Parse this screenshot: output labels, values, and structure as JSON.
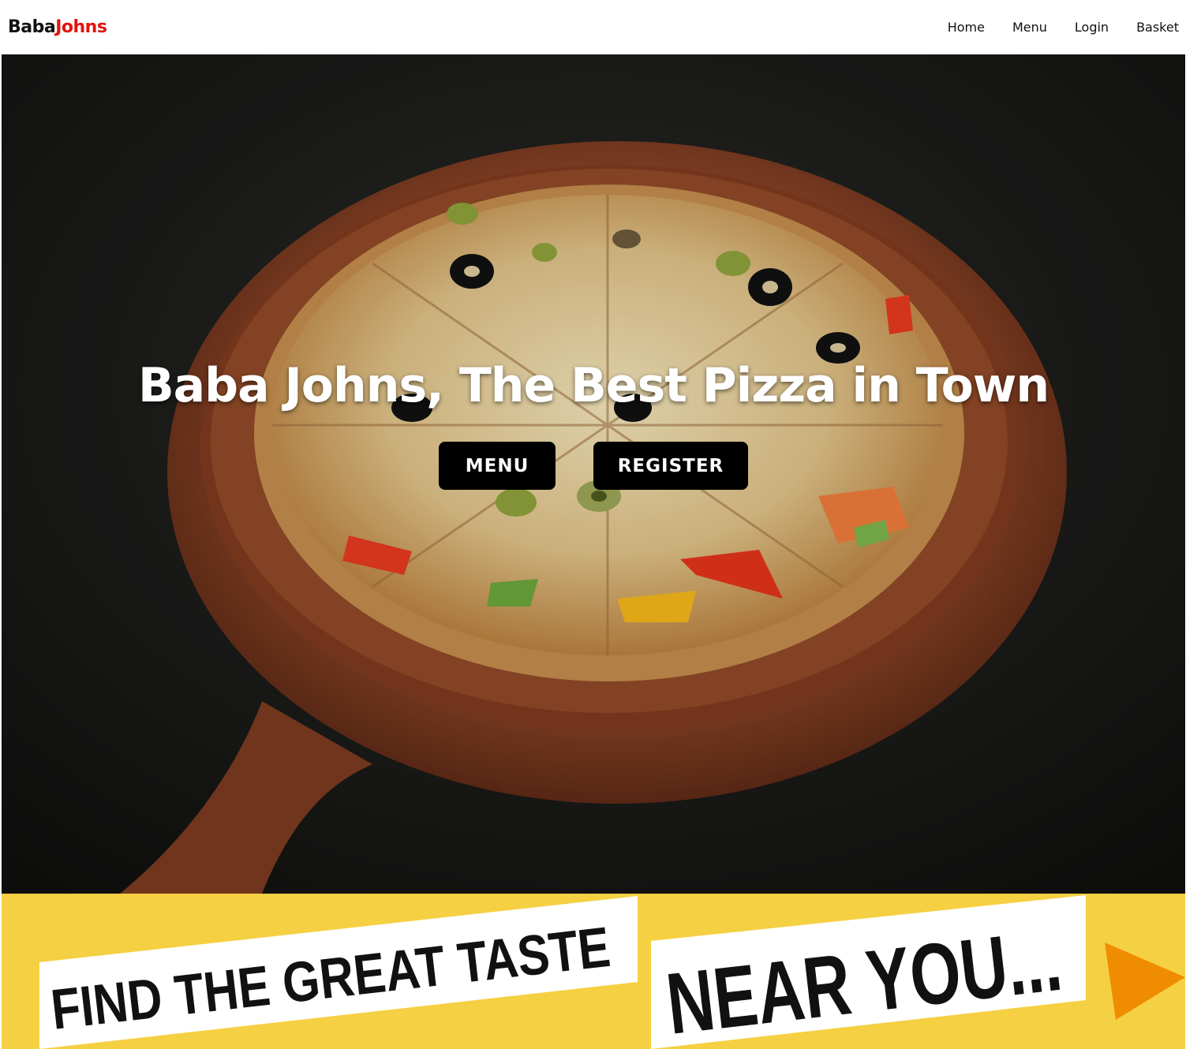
{
  "navbar": {
    "brand_part1": "Baba",
    "brand_part2": "Johns",
    "links": [
      "Home",
      "Menu",
      "Login",
      "Basket"
    ]
  },
  "hero": {
    "title": "Baba Johns, The Best Pizza in Town",
    "menu_button": "MENU",
    "register_button": "REGISTER"
  },
  "banner": {
    "text1": "FIND THE GREAT TASTE",
    "text2": "NEAR YOU...",
    "icon": "play-triangle-icon"
  },
  "colors": {
    "brand_accent": "#e3120b",
    "banner_yellow": "#f5d043",
    "arrow_orange": "#f08c00"
  }
}
